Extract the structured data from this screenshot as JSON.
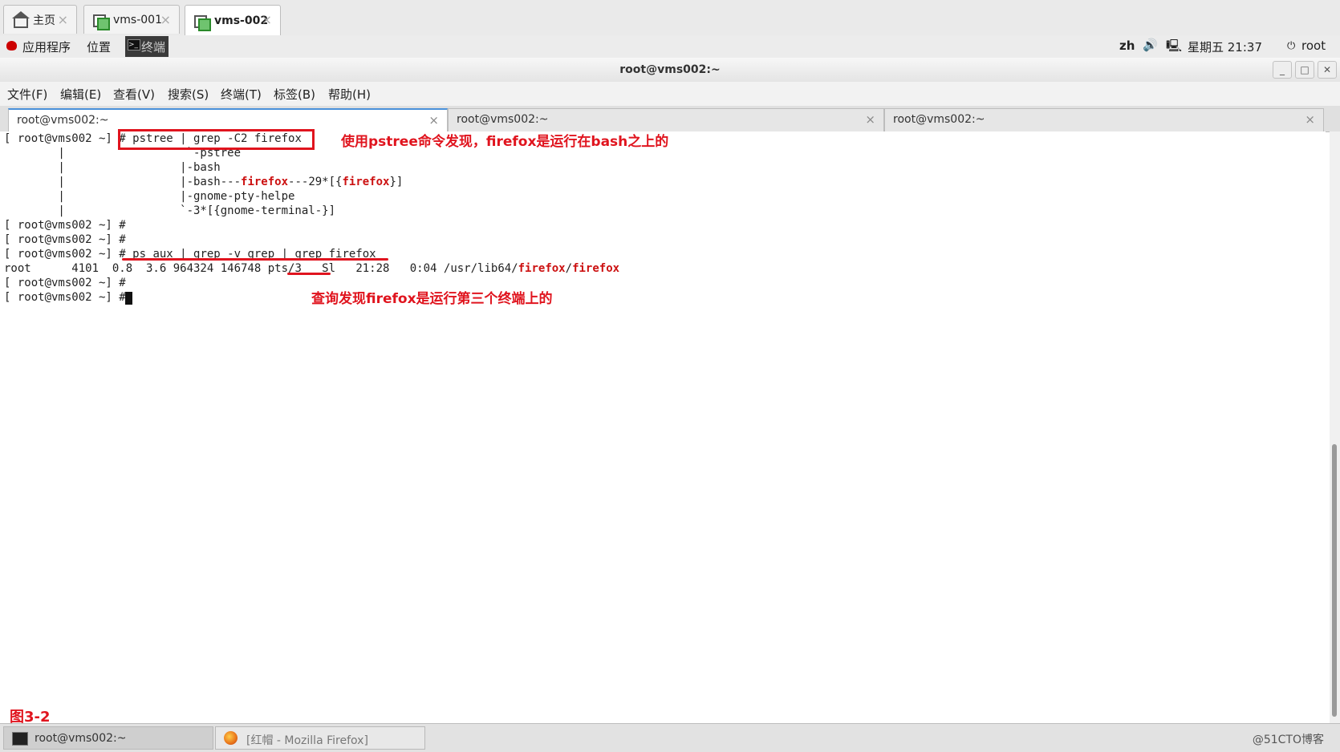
{
  "vm_tabs": [
    {
      "label": "主页",
      "icon": "home-icon"
    },
    {
      "label": "vms-001",
      "icon": "vm-icon"
    },
    {
      "label": "vms-002",
      "icon": "vm-icon"
    }
  ],
  "panel": {
    "apps": "应用程序",
    "places": "位置",
    "terminal": "终端",
    "lang": "zh",
    "datetime": "星期五 21:37",
    "user": "root"
  },
  "window": {
    "title": "root@vms002:~"
  },
  "menu": [
    "文件(F)",
    "编辑(E)",
    "查看(V)",
    "搜索(S)",
    "终端(T)",
    "标签(B)",
    "帮助(H)"
  ],
  "terminal_tabs": [
    "root@vms002:~",
    "root@vms002:~",
    "root@vms002:~"
  ],
  "terminal": {
    "prompt": "[ root@vms002 ~] # ",
    "cmd1": "pstree | grep -C2 firefox",
    "tree": [
      "        |                  `-pstree",
      "        |                 |-bash",
      "        |                 |-bash---",
      "        |                 |-gnome-pty-helpe",
      "        |                 `-3*[{gnome-terminal-}]"
    ],
    "tree_ff1": "firefox",
    "tree_mid": "---29*[{",
    "tree_ff2": "firefox",
    "tree_end": "}]",
    "cmd2": "ps aux | grep -v grep | grep firefox",
    "ps_pre": "root      4101  0.8  3.6 964324 146748 ",
    "ps_tty": "pts/3",
    "ps_post": "   Sl   21:28   0:04 /usr/lib64/",
    "ps_ff1": "firefox",
    "ps_sep": "/",
    "ps_ff2": "firefox"
  },
  "annotations": {
    "note1": "使用pstree命令发现，firefox是运行在bash之上的",
    "note2": "查询发现firefox是运行第三个终端上的",
    "figure": "图3-2"
  },
  "taskbar": {
    "items": [
      "root@vms002:~",
      "[红帽 - Mozilla Firefox]"
    ],
    "watermark": "@51CTO博客"
  },
  "colors": {
    "annotation": "#e0141e",
    "highlight": "#cc1111"
  }
}
